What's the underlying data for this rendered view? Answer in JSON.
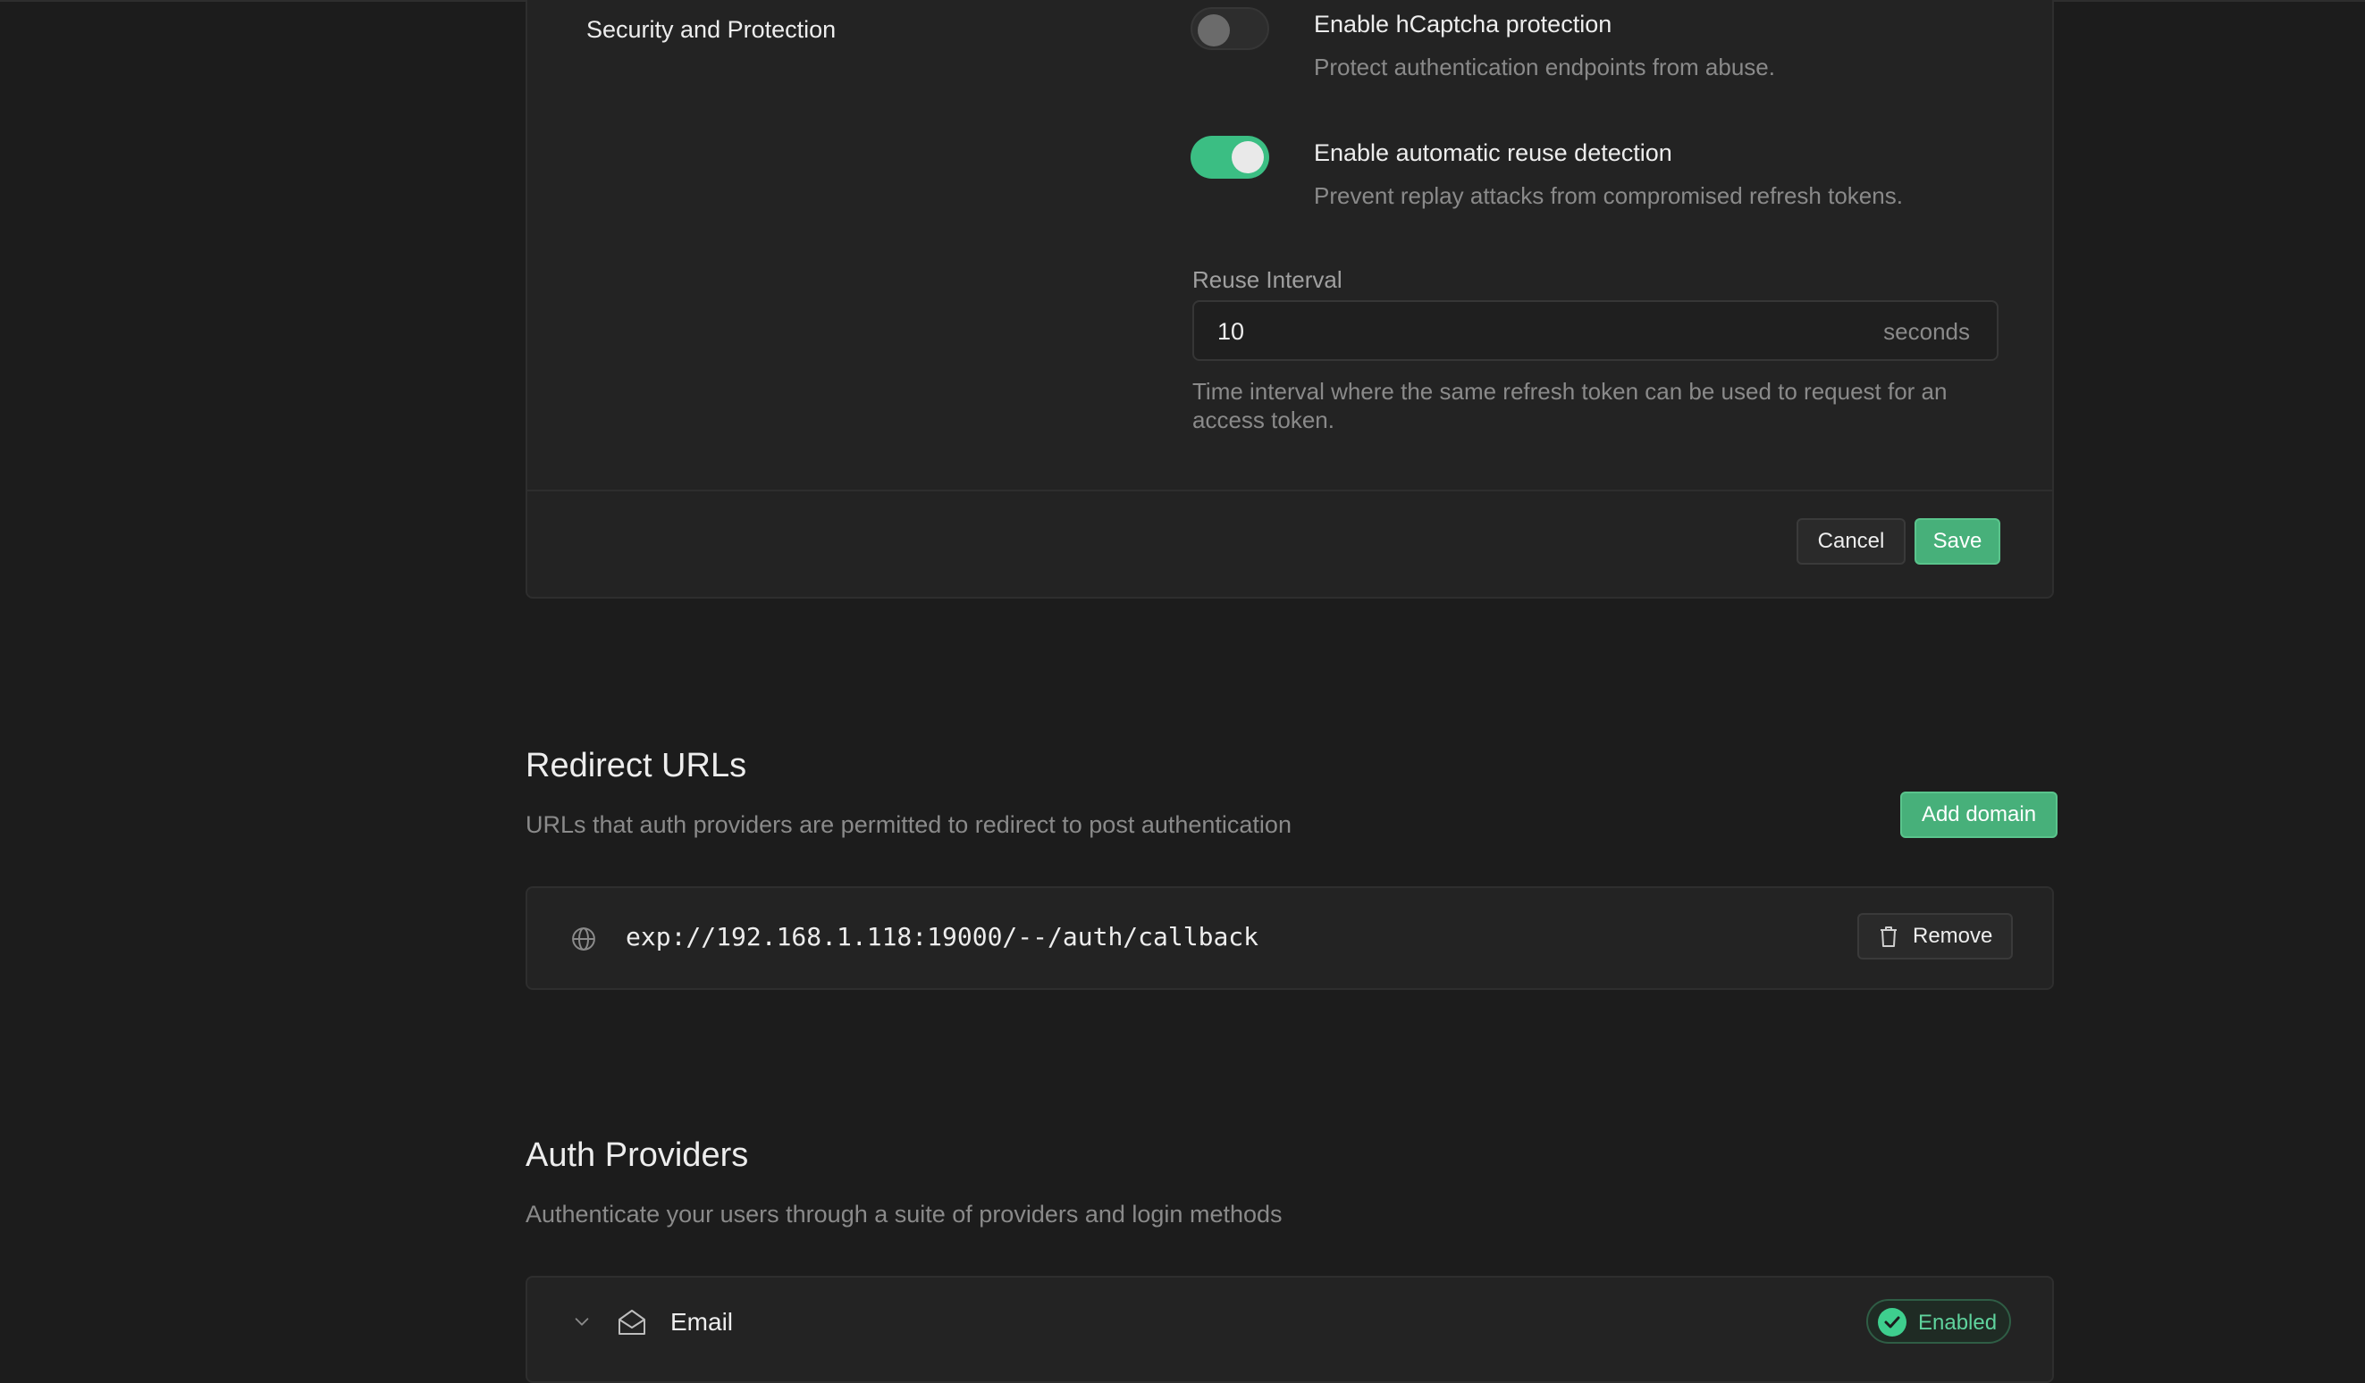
{
  "security": {
    "section_title": "Security and Protection",
    "hcaptcha": {
      "title": "Enable hCaptcha protection",
      "description": "Protect authentication endpoints from abuse.",
      "enabled": false
    },
    "reuse_detection": {
      "title": "Enable automatic reuse detection",
      "description": "Prevent replay attacks from compromised refresh tokens.",
      "enabled": true
    },
    "reuse_interval": {
      "label": "Reuse Interval",
      "value": "10",
      "suffix": "seconds",
      "help": "Time interval where the same refresh token can be used to request for an access token."
    },
    "cancel_label": "Cancel",
    "save_label": "Save"
  },
  "redirect_urls": {
    "title": "Redirect URLs",
    "subtitle": "URLs that auth providers are permitted to redirect to post authentication",
    "add_label": "Add domain",
    "items": [
      {
        "url": "exp://192.168.1.118:19000/--/auth/callback",
        "remove_label": "Remove"
      }
    ]
  },
  "auth_providers": {
    "title": "Auth Providers",
    "subtitle": "Authenticate your users through a suite of providers and login methods",
    "items": [
      {
        "name": "Email",
        "status": "Enabled",
        "icon": "envelope-icon"
      }
    ]
  },
  "colors": {
    "background": "#1c1c1c",
    "card": "#232323",
    "accent": "#3ecf8e"
  }
}
